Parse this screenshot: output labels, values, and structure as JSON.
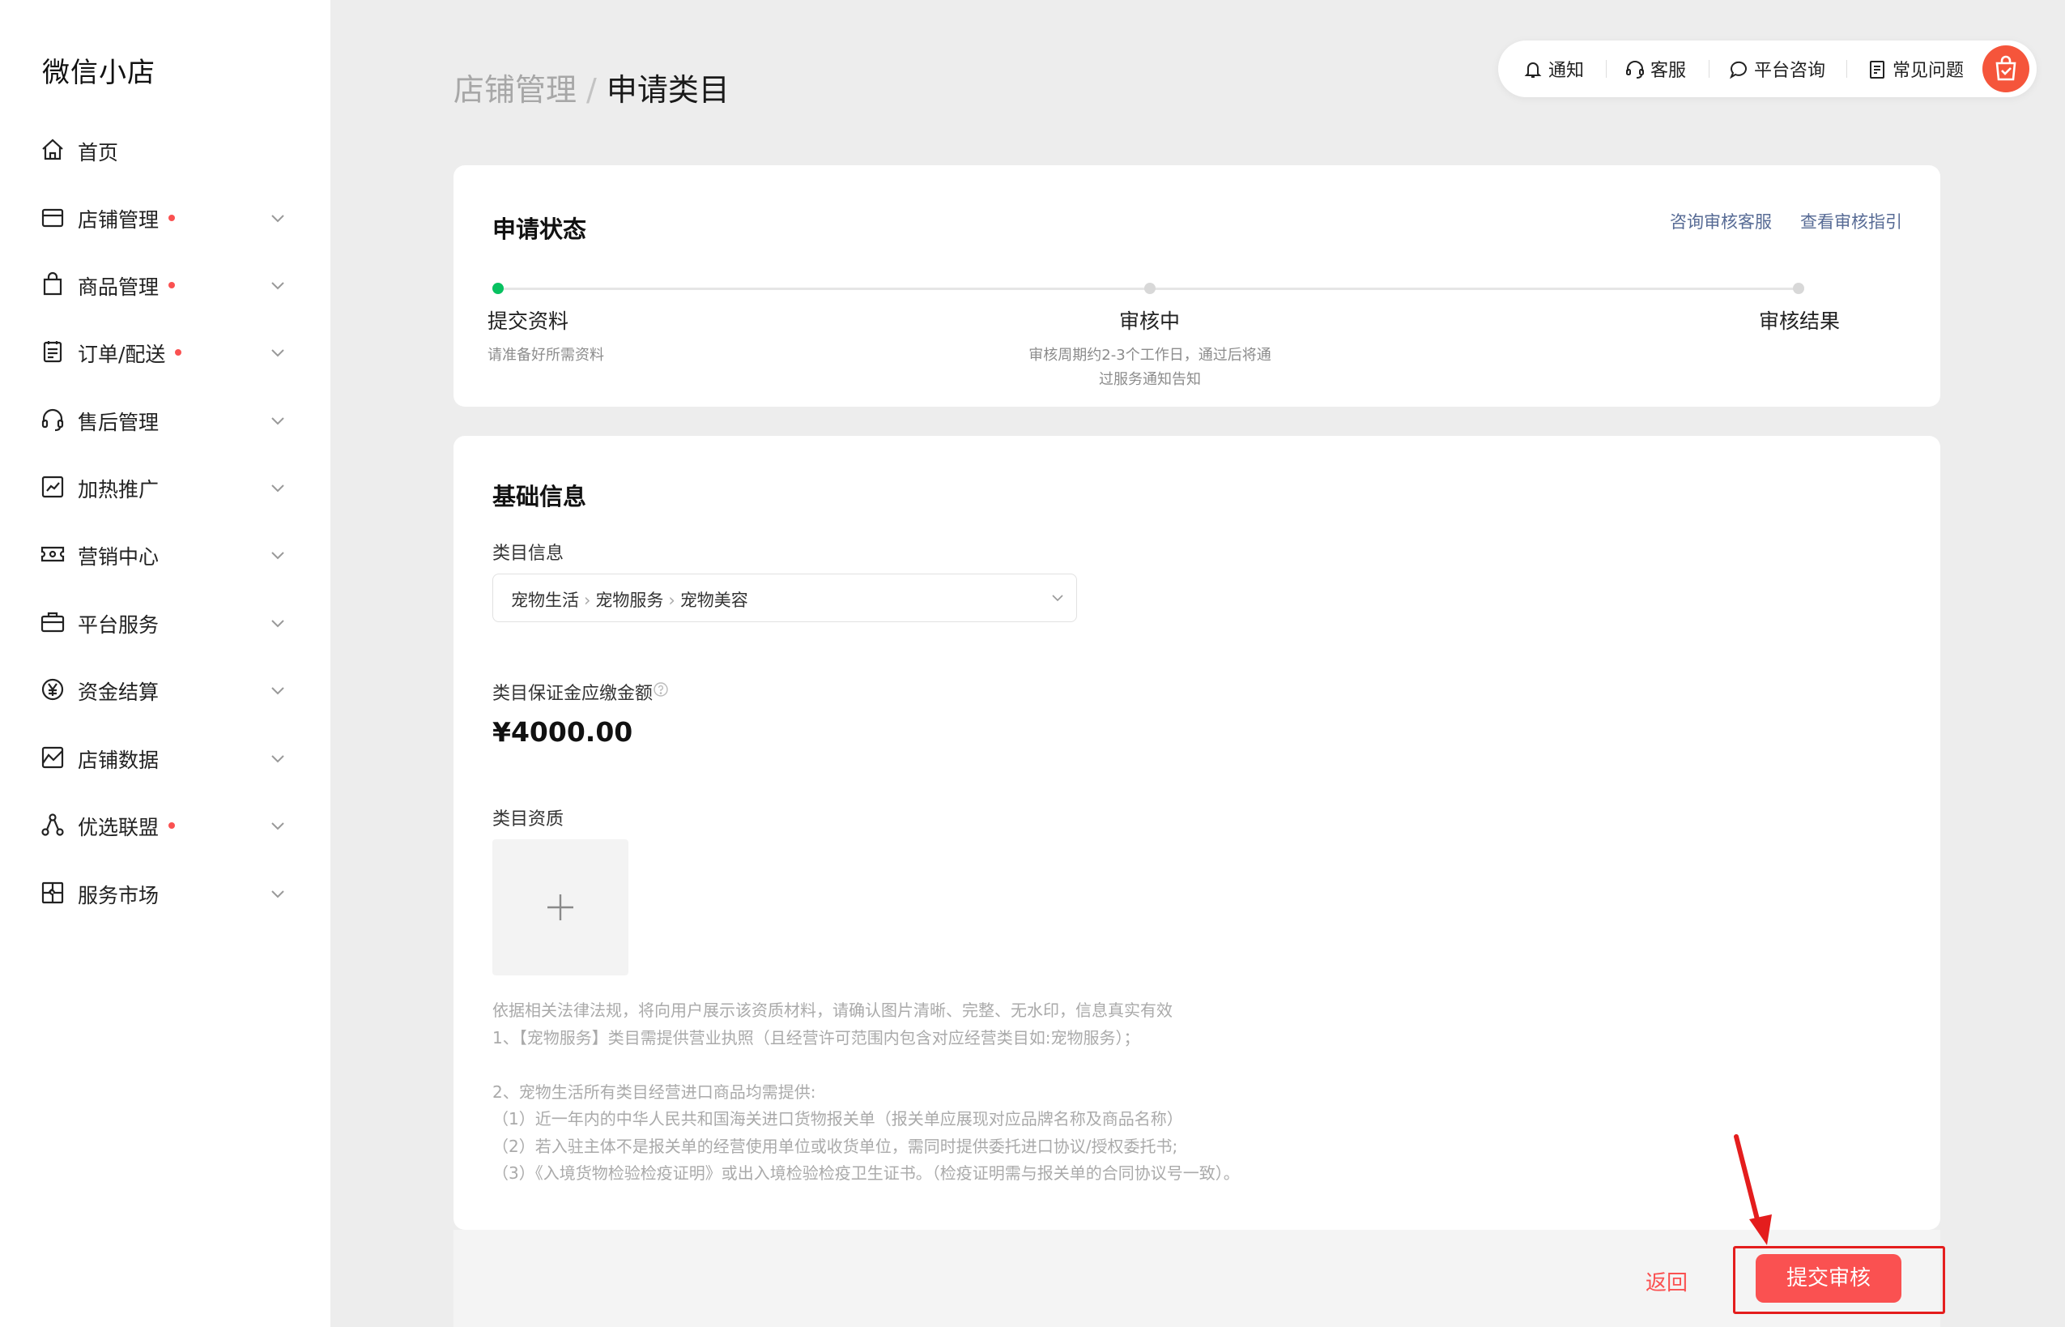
{
  "app": {
    "title": "微信小店"
  },
  "sidebar": {
    "items": [
      {
        "label": "首页",
        "icon": "home-icon",
        "dot": false,
        "expandable": false
      },
      {
        "label": "店铺管理",
        "icon": "store-icon",
        "dot": true,
        "expandable": true
      },
      {
        "label": "商品管理",
        "icon": "shopping-bag-icon",
        "dot": true,
        "expandable": true
      },
      {
        "label": "订单/配送",
        "icon": "order-clipboard-icon",
        "dot": true,
        "expandable": true
      },
      {
        "label": "售后管理",
        "icon": "headset-icon",
        "dot": false,
        "expandable": true
      },
      {
        "label": "加热推广",
        "icon": "trend-chart-icon",
        "dot": false,
        "expandable": true
      },
      {
        "label": "营销中心",
        "icon": "ticket-icon",
        "dot": false,
        "expandable": true
      },
      {
        "label": "平台服务",
        "icon": "briefcase-icon",
        "dot": false,
        "expandable": true
      },
      {
        "label": "资金结算",
        "icon": "yuan-icon",
        "dot": false,
        "expandable": true
      },
      {
        "label": "店铺数据",
        "icon": "data-chart-icon",
        "dot": false,
        "expandable": true
      },
      {
        "label": "优选联盟",
        "icon": "network-icon",
        "dot": true,
        "expandable": true
      },
      {
        "label": "服务市场",
        "icon": "puzzle-icon",
        "dot": false,
        "expandable": true
      }
    ]
  },
  "breadcrumb": {
    "parent": "店铺管理",
    "separator": "/",
    "current": "申请类目"
  },
  "topbar": {
    "notify": "通知",
    "service": "客服",
    "consult": "平台咨询",
    "faq": "常见问题",
    "avatar_icon": "shop-avatar-icon"
  },
  "status_card": {
    "title": "申请状态",
    "link_consult": "咨询审核客服",
    "link_guide": "查看审核指引",
    "steps": [
      {
        "title": "提交资料",
        "desc": "请准备好所需资料",
        "active": true
      },
      {
        "title": "审核中",
        "desc": "审核周期约2-3个工作日，通过后将通过服务通知告知",
        "active": false
      },
      {
        "title": "审核结果",
        "desc": "",
        "active": false
      }
    ]
  },
  "info_card": {
    "title": "基础信息",
    "category_label": "类目信息",
    "category_path": [
      "宠物生活",
      "宠物服务",
      "宠物美容"
    ],
    "deposit_label": "类目保证金应缴金额",
    "deposit_amount": "¥4000.00",
    "qualification_label": "类目资质",
    "notes": [
      "依据相关法律法规，将向用户展示该资质材料，请确认图片清晰、完整、无水印，信息真实有效",
      "1、【宠物服务】类目需提供营业执照（且经营许可范围内包含对应经营类目如:宠物服务）；",
      "",
      "2、宠物生活所有类目经营进口商品均需提供:",
      "（1）近一年内的中华人民共和国海关进口货物报关单（报关单应展现对应品牌名称及商品名称）",
      "（2）若入驻主体不是报关单的经营使用单位或收货单位，需同时提供委托进口协议/授权委托书;",
      "（3）《入境货物检验检疫证明》或出入境检验检疫卫生证书。（检疫证明需与报关单的合同协议号一致）。"
    ]
  },
  "footer": {
    "back_label": "返回",
    "submit_label": "提交审核"
  },
  "colors": {
    "brand_red": "#fa5151",
    "step_green": "#07c160",
    "link_blue": "#576b95"
  }
}
